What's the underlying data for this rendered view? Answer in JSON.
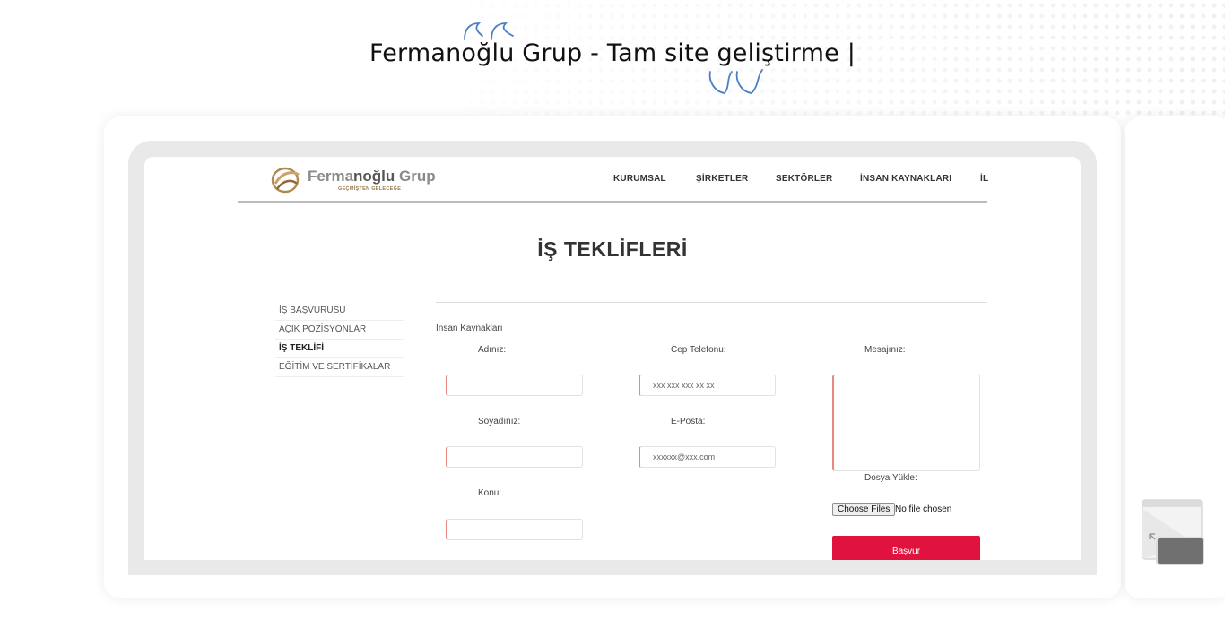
{
  "headline": "Fermanoğlu Grup - Tam site geliştirme |",
  "colors": {
    "accent": "#e0123e",
    "quote": "#4a7fc8",
    "input_border": "#e9877f"
  },
  "site": {
    "logo": {
      "name_light": "Ferma",
      "name_dark": "noğlu",
      "name_end": " Grup",
      "tagline": "GEÇMİŞTEN GELECEĞE"
    },
    "nav": [
      "KURUMSAL",
      "ŞİRKETLER",
      "SEKTÖRLER",
      "İNSAN KAYNAKLARI",
      "İL"
    ],
    "page_title": "İŞ TEKLİFLERİ",
    "sidebar": [
      {
        "label": "İŞ BAŞVURUSU",
        "active": false
      },
      {
        "label": "AÇIK POZİSYONLAR",
        "active": false
      },
      {
        "label": "İŞ TEKLİFİ",
        "active": true
      },
      {
        "label": "EĞİTİM VE SERTİFİKALAR",
        "active": false
      }
    ],
    "form": {
      "section": "İnsan Kaynakları",
      "name_label": "Adınız:",
      "surname_label": "Soyadınız:",
      "subject_label": "Konu:",
      "phone_label": "Cep Telefonu:",
      "phone_placeholder": "xxx xxx xxx xx xx",
      "email_label": "E-Posta:",
      "email_placeholder": "xxxxxx@xxx.com",
      "message_label": "Mesajınız:",
      "upload_label": "Dosya Yükle:",
      "choose_files": "Choose Files",
      "file_status": "No file chosen",
      "submit_label": "Başvur"
    }
  }
}
